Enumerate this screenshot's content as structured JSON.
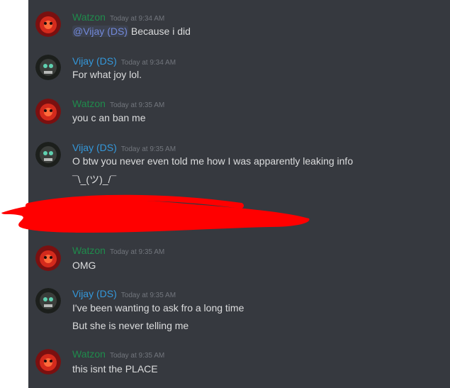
{
  "colors": {
    "chat_background": "#36393f",
    "message_text": "#dcddde",
    "timestamp": "#72767d",
    "username_watzon": "#1f8b4c",
    "username_vijay": "#3498db",
    "mention": "#7289da",
    "redaction": "#ff0000"
  },
  "messages": [
    {
      "author": "Watzon",
      "timestamp": "Today at 9:34 AM",
      "avatar_icon": "red-avatar-icon",
      "mention": "@Vijay (DS)",
      "lines": [
        " Because i did"
      ]
    },
    {
      "author": "Vijay (DS)",
      "timestamp": "Today at 9:34 AM",
      "avatar_icon": "dark-avatar-icon",
      "lines": [
        "For what joy lol."
      ]
    },
    {
      "author": "Watzon",
      "timestamp": "Today at 9:35 AM",
      "avatar_icon": "red-avatar-icon",
      "lines": [
        "you c an ban me"
      ]
    },
    {
      "author": "Vijay (DS)",
      "timestamp": "Today at 9:35 AM",
      "avatar_icon": "dark-avatar-icon",
      "lines": [
        "O btw you never even told me how I was apparently leaking info",
        "¯\\_(ツ)_/¯"
      ]
    },
    {
      "author": "Watzon",
      "timestamp": "Today at 9:35 AM",
      "avatar_icon": "red-avatar-icon",
      "lines": [
        "OMG"
      ]
    },
    {
      "author": "Vijay (DS)",
      "timestamp": "Today at 9:35 AM",
      "avatar_icon": "dark-avatar-icon",
      "lines": [
        "I've been wanting to ask fro a long time",
        "But she is never telling me"
      ]
    },
    {
      "author": "Watzon",
      "timestamp": "Today at 9:35 AM",
      "avatar_icon": "red-avatar-icon",
      "lines": [
        "this isnt the PLACE"
      ]
    }
  ]
}
